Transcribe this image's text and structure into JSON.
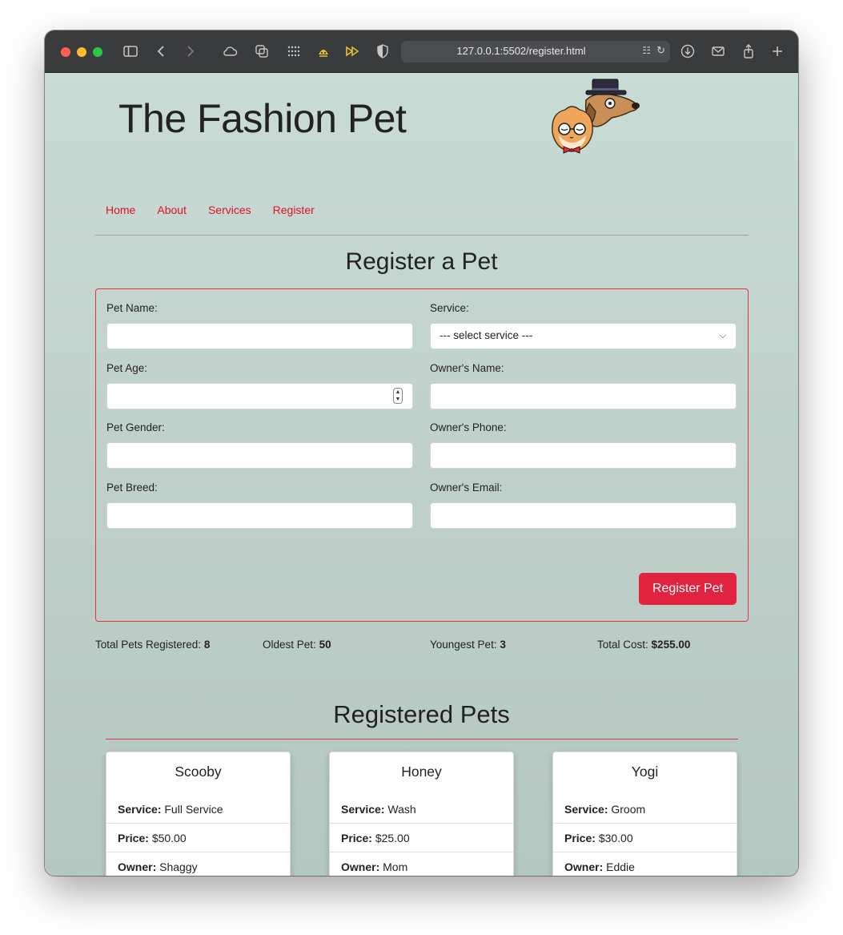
{
  "browser": {
    "url": "127.0.0.1:5502/register.html"
  },
  "site": {
    "title": "The Fashion Pet"
  },
  "nav": {
    "items": [
      "Home",
      "About",
      "Services",
      "Register"
    ]
  },
  "form": {
    "heading": "Register a Pet",
    "pet_name_label": "Pet Name:",
    "pet_age_label": "Pet Age:",
    "pet_gender_label": "Pet Gender:",
    "pet_breed_label": "Pet Breed:",
    "service_label": "Service:",
    "service_selected": "--- select service ---",
    "owner_name_label": "Owner's Name:",
    "owner_phone_label": "Owner's Phone:",
    "owner_email_label": "Owner's Email:",
    "submit_label": "Register Pet"
  },
  "stats": {
    "total_label": "Total Pets Registered:",
    "total_value": "8",
    "oldest_label": "Oldest Pet:",
    "oldest_value": "50",
    "youngest_label": "Youngest Pet:",
    "youngest_value": "3",
    "cost_label": "Total Cost:",
    "cost_value": "$255.00"
  },
  "pets": {
    "heading": "Registered Pets",
    "service_label": "Service:",
    "price_label": "Price:",
    "owner_label": "Owner:",
    "cards": [
      {
        "name": "Scooby",
        "service": "Full Service",
        "price": "$50.00",
        "owner": "Shaggy"
      },
      {
        "name": "Honey",
        "service": "Wash",
        "price": "$25.00",
        "owner": "Mom"
      },
      {
        "name": "Yogi",
        "service": "Groom",
        "price": "$30.00",
        "owner": "Eddie"
      }
    ]
  },
  "colors": {
    "accent": "#e2233f",
    "page_bg": "#c3d3cd"
  }
}
